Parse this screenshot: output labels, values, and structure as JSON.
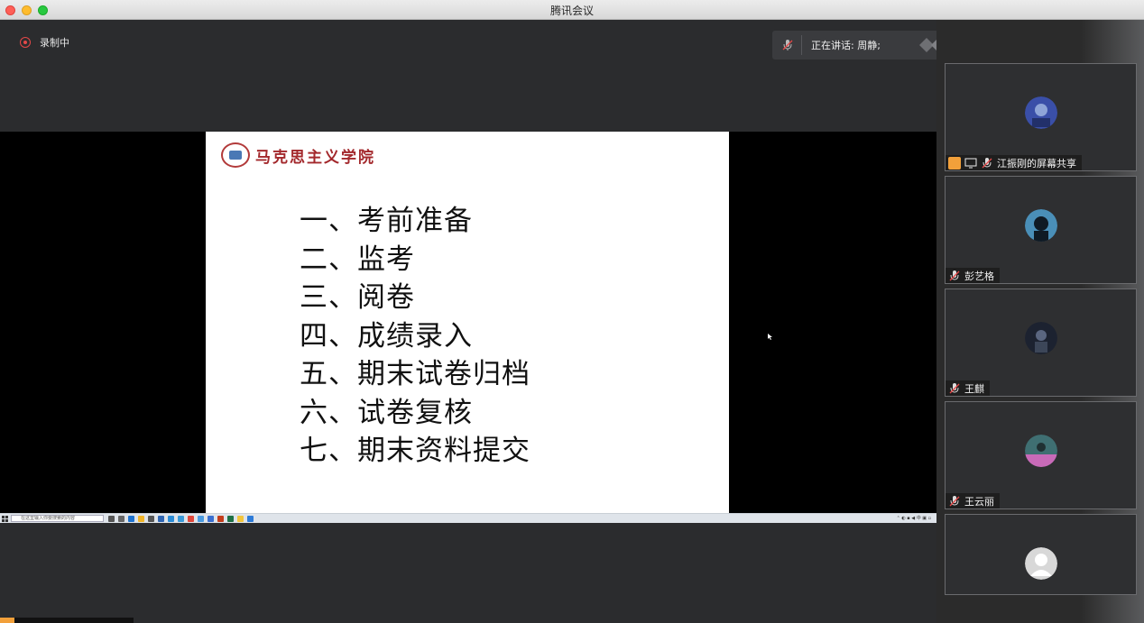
{
  "window": {
    "title": "腾讯会议"
  },
  "recording": {
    "label": "录制中"
  },
  "speaking": {
    "label": "正在讲话: 周静;"
  },
  "slide": {
    "logo_text": "马克思主义学院",
    "items": [
      "一、考前准备",
      "二、监考",
      "三、阅卷",
      "四、成绩录入",
      "五、期末试卷归档",
      "六、试卷复核",
      "七、期末资料提交"
    ]
  },
  "taskbar": {
    "search_placeholder": "在这里输入你要搜索的内容"
  },
  "participants": [
    {
      "name": "江振刚的屏幕共享",
      "avatar_color": "#3a4fa8"
    },
    {
      "name": "彭艺格",
      "avatar_color": "#4a8fb8"
    },
    {
      "name": "王麒",
      "avatar_color": "#1c2230"
    },
    {
      "name": "王云丽",
      "avatar_color": "#3f6f72"
    },
    {
      "name": "",
      "avatar_color": "#d8d8d8"
    }
  ],
  "colors": {
    "accent_red": "#a3282c",
    "rec_red": "#e54848",
    "share_orange": "#f2a03a"
  }
}
